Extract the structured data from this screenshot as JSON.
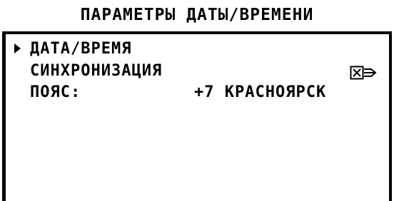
{
  "screen": {
    "title": "ПАРАМЕТРЫ ДАТЫ/ВРЕМЕНИ"
  },
  "menu": {
    "items": [
      {
        "label": "ДАТА/ВРЕМЯ",
        "selected": true
      },
      {
        "label": "СИНХРОНИЗАЦИЯ",
        "icon": "sync-status-icon"
      },
      {
        "label": "ПОЯС:",
        "value": "+7 КРАСНОЯРСК"
      }
    ]
  }
}
